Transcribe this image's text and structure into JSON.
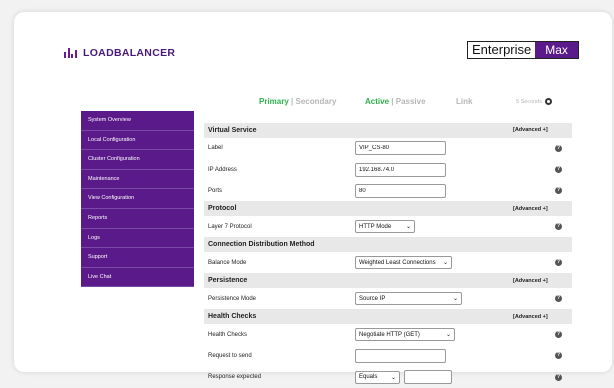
{
  "brand": {
    "logo_text": "LOADBALANCER",
    "edition_left": "Enterprise",
    "edition_right": "Max",
    "brand_color": "#5a1a8a"
  },
  "status": {
    "primary": "Primary",
    "separator": "|",
    "secondary": "Secondary",
    "active": "Active",
    "passive": "Passive",
    "link": "Link",
    "refresh": "5 Seconds"
  },
  "sidebar": {
    "items": [
      {
        "label": "System Overview"
      },
      {
        "label": "Local Configuration"
      },
      {
        "label": "Cluster Configuration"
      },
      {
        "label": "Maintenance"
      },
      {
        "label": "View Configuration"
      },
      {
        "label": "Reports"
      },
      {
        "label": "Logs"
      },
      {
        "label": "Support"
      },
      {
        "label": "Live Chat"
      }
    ]
  },
  "form": {
    "virtual_service": {
      "title": "Virtual Service",
      "advanced": "[Advanced +]"
    },
    "label": {
      "label": "Label",
      "value": "VIP_CS-80"
    },
    "ip": {
      "label": "IP Address",
      "value": "192.168.74.0"
    },
    "ports": {
      "label": "Ports",
      "value": "80"
    },
    "protocol": {
      "title": "Protocol",
      "advanced": "[Advanced +]"
    },
    "layer7": {
      "label": "Layer 7 Protocol",
      "value": "HTTP Mode"
    },
    "cdm": {
      "title": "Connection Distribution Method"
    },
    "balance": {
      "label": "Balance Mode",
      "value": "Weighted Least Connections"
    },
    "persistence": {
      "title": "Persistence",
      "advanced": "[Advanced +]"
    },
    "pmode": {
      "label": "Persistence Mode",
      "value": "Source IP"
    },
    "health": {
      "title": "Health Checks",
      "advanced": "[Advanced +]"
    },
    "hc": {
      "label": "Health Checks",
      "value": "Negotiate HTTP (GET)"
    },
    "request": {
      "label": "Request to send",
      "value": ""
    },
    "response": {
      "label": "Response expected",
      "value": "Equals"
    },
    "help_icon": "?"
  }
}
